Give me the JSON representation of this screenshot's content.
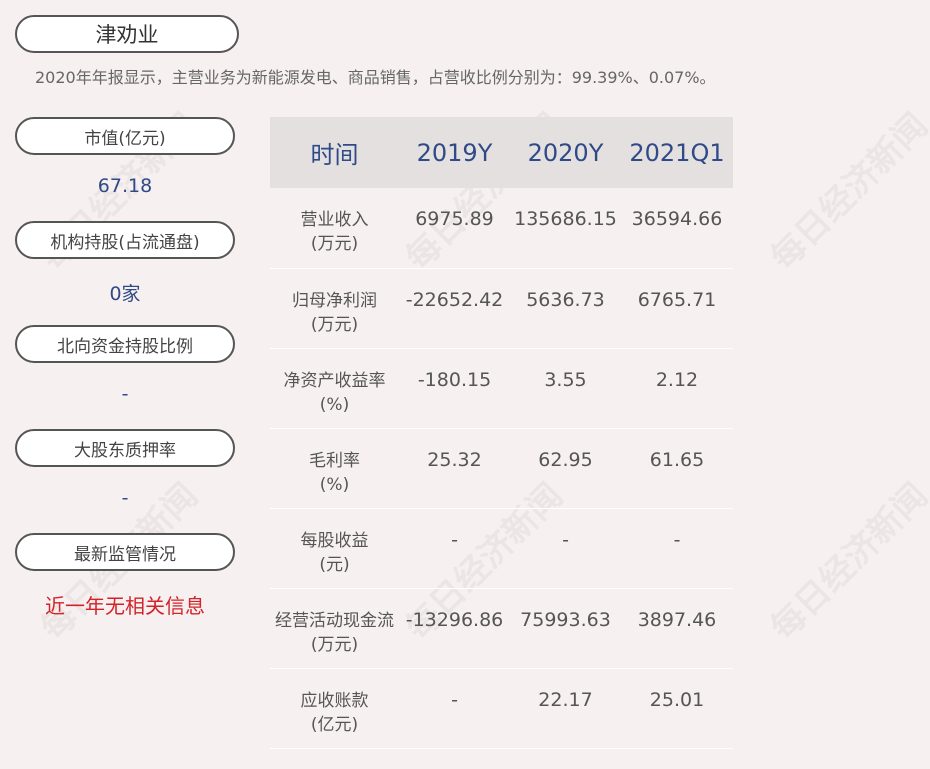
{
  "title": "津劝业",
  "summary": "2020年年报显示，主营业务为新能源发电、商品销售，占营收比例分别为：99.39%、0.07%。",
  "watermark": "每日经济新闻",
  "sidebar": [
    {
      "label": "市值(亿元)",
      "value": "67.18"
    },
    {
      "label": "机构持股(占流通盘)",
      "value": "0家"
    },
    {
      "label": "北向资金持股比例",
      "value": "-"
    },
    {
      "label": "大股东质押率",
      "value": "-"
    },
    {
      "label": "最新监管情况",
      "value": "近一年无相关信息"
    }
  ],
  "table": {
    "headers": [
      "时间",
      "2019Y",
      "2020Y",
      "2021Q1"
    ],
    "rows": [
      {
        "label": "营业收入",
        "unit": "(万元)",
        "values": [
          "6975.89",
          "135686.15",
          "36594.66"
        ]
      },
      {
        "label": "归母净利润",
        "unit": "(万元)",
        "values": [
          "-22652.42",
          "5636.73",
          "6765.71"
        ]
      },
      {
        "label": "净资产收益率",
        "unit": "(%)",
        "values": [
          "-180.15",
          "3.55",
          "2.12"
        ]
      },
      {
        "label": "毛利率",
        "unit": "(%)",
        "values": [
          "25.32",
          "62.95",
          "61.65"
        ]
      },
      {
        "label": "每股收益",
        "unit": "(元)",
        "values": [
          "-",
          "-",
          "-"
        ]
      },
      {
        "label": "经营活动现金流",
        "unit": "(万元)",
        "values": [
          "-13296.86",
          "75993.63",
          "3897.46"
        ]
      },
      {
        "label": "应收账款",
        "unit": "(亿元)",
        "values": [
          "-",
          "22.17",
          "25.01"
        ]
      }
    ]
  },
  "colors": {
    "background": "#f7f0f0",
    "header_bg": "#e4e0e0",
    "header_text": "#2f4a87",
    "value_text": "#2f4a87",
    "alert_text": "#d2232a"
  }
}
